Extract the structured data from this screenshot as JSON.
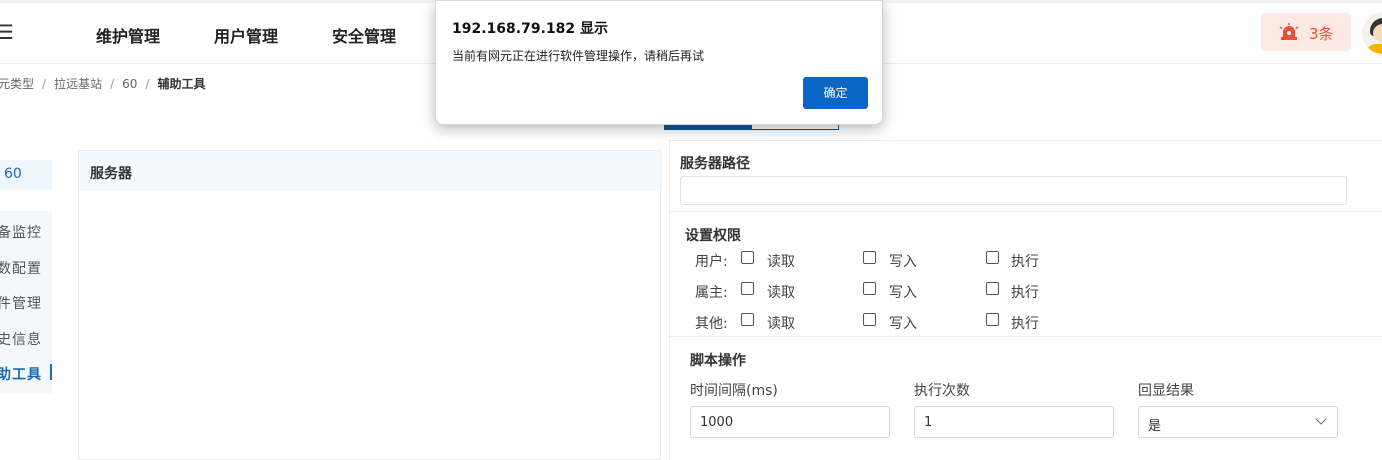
{
  "header": {
    "menu_icon": "hamburger-icon",
    "nav": [
      "维护管理",
      "用户管理",
      "安全管理"
    ],
    "alarm": {
      "icon": "alarm-light-icon",
      "count": "3条",
      "color": "#e8503a"
    },
    "avatar_icon": "user-avatar-icon"
  },
  "breadcrumb": [
    "元类型",
    "拉远基站",
    "60",
    "辅助工具"
  ],
  "breadcrumb_sep": "/",
  "sidebar": {
    "node": "60",
    "items": [
      "备监控",
      "数配置",
      "件管理",
      "史信息",
      "助工具"
    ],
    "active_index": 4
  },
  "server": {
    "title": "服务器"
  },
  "form": {
    "server_path_label": "服务器路径",
    "server_path_value": "",
    "permissions_title": "设置权限",
    "permission_rows": [
      "用户:",
      "属主:",
      "其他:"
    ],
    "permission_cols": [
      "读取",
      "写入",
      "执行"
    ],
    "script_title": "脚本操作",
    "interval_label": "时间间隔(ms)",
    "interval_value": "1000",
    "count_label": "执行次数",
    "count_value": "1",
    "echo_label": "回显结果",
    "echo_value": "是"
  },
  "dialog": {
    "title": "192.168.79.182 显示",
    "message": "当前有网元正在进行软件管理操作，请稍后再试",
    "ok_label": "确定"
  },
  "colors": {
    "accent": "#0c5a99",
    "dialog_button": "#0a66c7"
  }
}
